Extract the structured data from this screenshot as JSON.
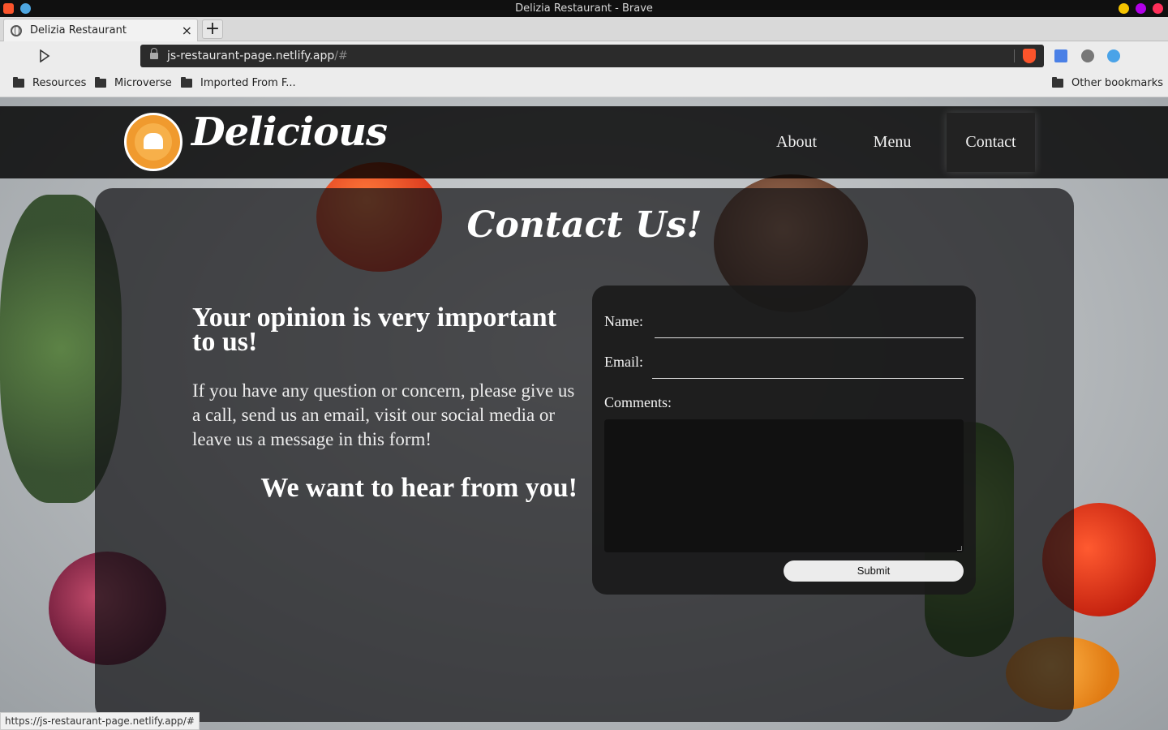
{
  "window": {
    "title": "Delizia Restaurant - Brave"
  },
  "tab": {
    "label": "Delizia Restaurant",
    "close": "×",
    "new_tab": "+"
  },
  "address": {
    "host": "js-restaurant-page.netlify.app",
    "path": "/#"
  },
  "bookmarks": {
    "items": [
      "Resources",
      "Microverse",
      "Imported From F..."
    ],
    "other": "Other bookmarks"
  },
  "site": {
    "brand": "Delicious",
    "nav": [
      "About",
      "Menu",
      "Contact"
    ],
    "active_nav": "Contact"
  },
  "contact": {
    "title": "Contact Us!",
    "heading": "Your opinion is very important to us!",
    "paragraph": "If you have any question or concern, please give us a call, send us an email, visit our social media or leave us a message in this form!",
    "tagline": "We want to hear from you!"
  },
  "form": {
    "name_label": "Name:",
    "email_label": "Email:",
    "comments_label": "Comments:",
    "submit_label": "Submit"
  },
  "status_bar": {
    "url": "https://js-restaurant-page.netlify.app/#"
  },
  "colors": {
    "accent_orange": "#f09a2e",
    "brave_orange": "#fb542b",
    "header_bg": "#000000",
    "traffic_yellow": "#f5c400",
    "traffic_purple": "#b100e8",
    "traffic_red": "#ff2f5a"
  }
}
